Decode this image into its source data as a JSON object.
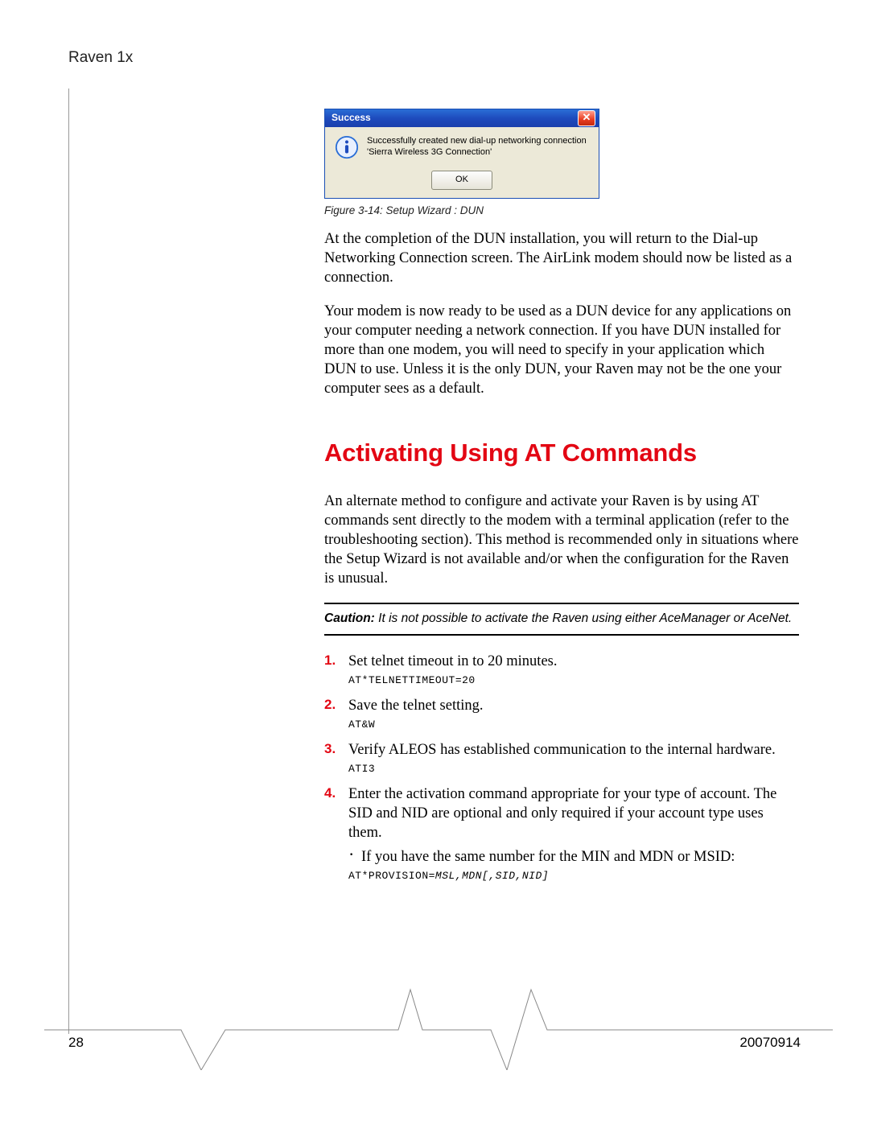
{
  "header": {
    "doc_title": "Raven 1x"
  },
  "dialog": {
    "title": "Success",
    "close_glyph": "✕",
    "message_line1": "Successfully created new dial-up networking connection",
    "message_line2": "'Sierra Wireless 3G Connection'",
    "ok_label": "OK"
  },
  "figure_caption": "Figure 3-14: Setup Wizard : DUN",
  "para1": "At the completion of the DUN installation, you will return to the Dial-up Networking Connection screen. The AirLink modem should now be listed as a connection.",
  "para2": "Your modem is now ready to be used as a DUN device for any applications on your computer needing a network connection. If you have DUN installed for more than one modem, you will need to specify in your application which DUN to use. Unless it is the only DUN, your Raven may not be the one your computer sees as a default.",
  "section_heading": "Activating Using AT Commands",
  "para3": "An alternate method to configure and activate your Raven is by using AT commands sent directly to the modem with a terminal application (refer to the troubleshooting section). This method is recommended only in situations where the Setup Wizard is not available and/or when the configuration for the Raven is unusual.",
  "caution": {
    "label": "Caution:",
    "text": " It is not possible to activate the Raven using either AceManager or AceNet."
  },
  "steps": [
    {
      "text": "Set telnet timeout in to 20 minutes.",
      "cmd": "AT*TELNETTIMEOUT=20"
    },
    {
      "text": "Save the telnet setting.",
      "cmd": "AT&W"
    },
    {
      "text": "Verify ALEOS has established communication to the internal hardware.",
      "cmd": "ATI3"
    },
    {
      "text": "Enter the activation command appropriate for your type of account.  The SID and NID are optional and only required if your account type uses them.",
      "sub": "If you have the same number for the MIN and MDN or MSID:",
      "cmd_prefix": "AT*PROVISION=",
      "cmd_var": "MSL,MDN[,SID,NID]"
    }
  ],
  "footer": {
    "page_number": "28",
    "doc_date": "20070914"
  }
}
